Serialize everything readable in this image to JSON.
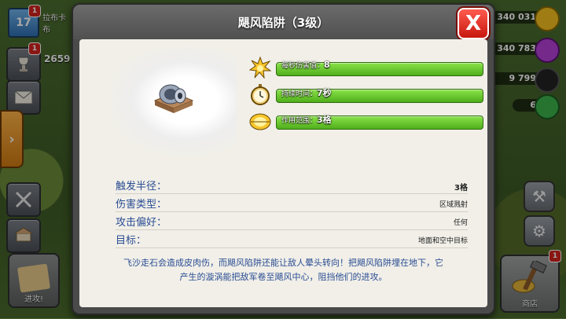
{
  "hud": {
    "player_level": "17",
    "player_name": "拉布卡布",
    "notif_count": "1",
    "trophy_badge": "1",
    "trophies": "2659",
    "side_tab_arrow": "›",
    "attack_label": "进攻!",
    "resources": [
      {
        "value": "340 031",
        "color": "#f4c020"
      },
      {
        "value": "340 783",
        "color": "#b23fd6"
      },
      {
        "value": "9 799",
        "color": "#222222"
      },
      {
        "value": "6",
        "color": "#3bb34a"
      }
    ],
    "shop_label": "商店",
    "shop_badge": "1"
  },
  "dialog": {
    "title": "飓风陷阱（3级）",
    "close_label": "X",
    "stats": [
      {
        "label": "每秒伤害值：",
        "value": "8",
        "icon": "explosion-icon"
      },
      {
        "label": "持续时间：",
        "value": "7秒",
        "icon": "stopwatch-icon"
      },
      {
        "label": "作用范围：",
        "value": "3格",
        "icon": "range-icon"
      }
    ],
    "info": [
      {
        "label": "触发半径：",
        "value": "3格"
      },
      {
        "label": "伤害类型：",
        "value": "区域溅射"
      },
      {
        "label": "攻击偏好：",
        "value": "任何"
      },
      {
        "label": "目标：",
        "value": "地面和空中目标"
      }
    ],
    "description_line1": "飞沙走石会造成皮肉伤，而飓风陷阱还能让敌人晕头转向！把飓风陷阱埋在地下，它",
    "description_line2": "产生的漩涡能把敌军卷至飓风中心，阻挡他们的进攻。"
  }
}
